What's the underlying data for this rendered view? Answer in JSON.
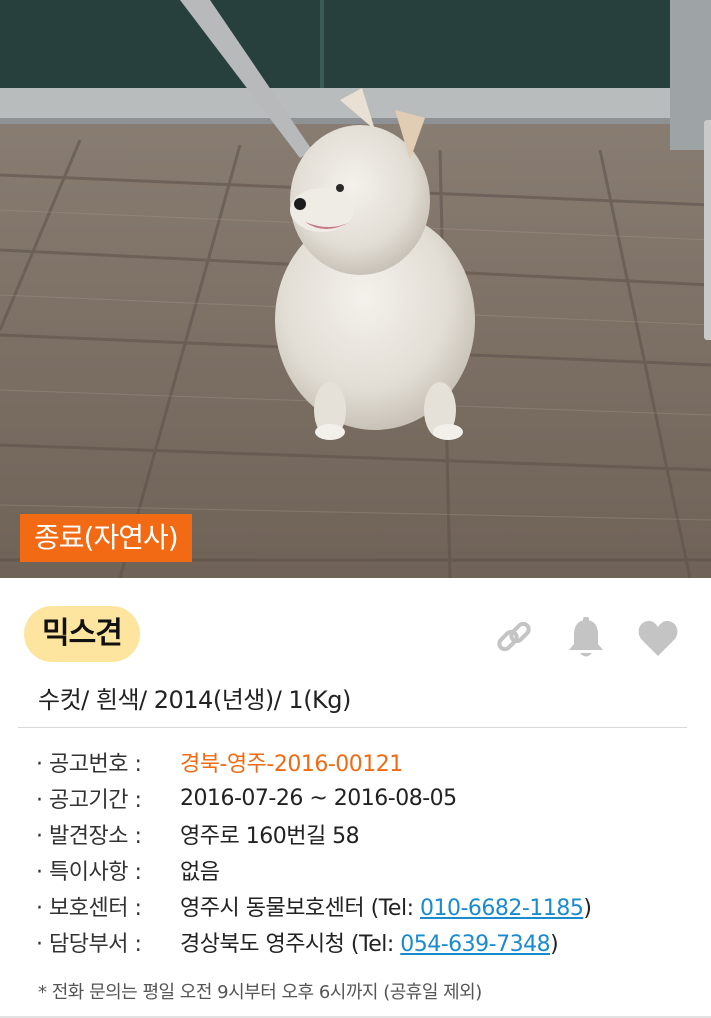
{
  "photo": {
    "status_badge": "종료(자연사)",
    "alt_subject": "white-pomeranian-dog"
  },
  "animal": {
    "breed": "믹스견",
    "summary": "수컷/ 흰색/ 2014(년생)/ 1(Kg)"
  },
  "actions": {
    "share_icon": "link-icon",
    "alert_icon": "bell-icon",
    "favorite_icon": "heart-icon"
  },
  "info": {
    "notice_no_label": "· 공고번호 :",
    "notice_no_value": "경북-영주-2016-00121",
    "period_label": "· 공고기간 :",
    "period_value": "2016-07-26 ~ 2016-08-05",
    "place_label": "· 발견장소 :",
    "place_value": "영주로 160번길 58",
    "note_label": "· 특이사항 :",
    "note_value": "없음",
    "shelter_label": "· 보호센터 :",
    "shelter_name": "영주시 동물보호센터 (Tel: ",
    "shelter_tel": "010-6682-1185",
    "shelter_close": ")",
    "dept_label": "· 담당부서 :",
    "dept_name": "경상북도 영주시청 (Tel: ",
    "dept_tel": "054-639-7348",
    "dept_close": ")"
  },
  "footnote": "* 전화 문의는 평일 오전 9시부터 오후 6시까지 (공휴일 제외)",
  "colors": {
    "accent": "#f26a13",
    "link": "#1a8bd0",
    "breed_pill": "#fde5a0",
    "icon_gray": "#c4c4c4"
  }
}
